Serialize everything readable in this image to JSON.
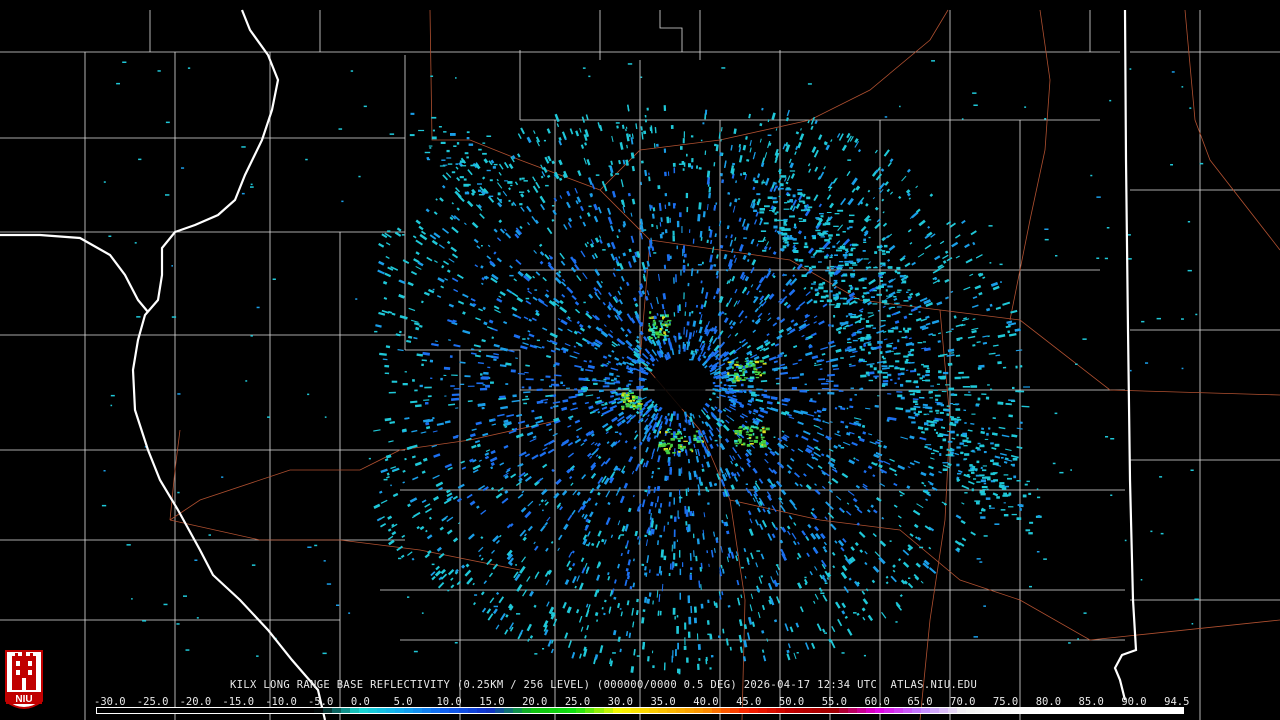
{
  "header": {
    "product_line": "KILX LONG RANGE BASE REFLECTIVITY (0.25KM / 256 LEVEL) (000000/0000 0.5 DEG) 2026-04-17 12:34 UTC  ATLAS.NIU.EDU"
  },
  "legend": {
    "labels": [
      "-30.0",
      "-25.0",
      "-20.0",
      "-15.0",
      "-10.0",
      "-5.0",
      "0.0",
      "5.0",
      "10.0",
      "15.0",
      "20.0",
      "25.0",
      "30.0",
      "35.0",
      "40.0",
      "45.0",
      "50.0",
      "55.0",
      "60.0",
      "65.0",
      "70.0",
      "75.0",
      "80.0",
      "85.0",
      "90.0",
      "94.5"
    ],
    "colors": [
      "#000000",
      "#000000",
      "#000000",
      "#000000",
      "#000000",
      "#000000",
      "#18d8d0",
      "#11a8ee",
      "#1060f0",
      "#1030c8",
      "#10c010",
      "#10e010",
      "#f8f800",
      "#f8c000",
      "#f89000",
      "#f82000",
      "#c00000",
      "#a00000",
      "#e000e0",
      "#c080ff",
      "#f0f0f0",
      "#f8f8f8",
      "#ffffff",
      "#ffffff",
      "#ffffff",
      "#ffffff"
    ]
  },
  "logo": {
    "text": "NIU"
  },
  "map": {
    "border_color": "#e8e8e8",
    "state_border_color": "#ffffff",
    "road_color": "#b05030",
    "echo_colors": [
      "#1fc8d8",
      "#1a9ee8",
      "#1c6ff0",
      "#2fe0c0",
      "#46d040",
      "#d8e020"
    ]
  }
}
